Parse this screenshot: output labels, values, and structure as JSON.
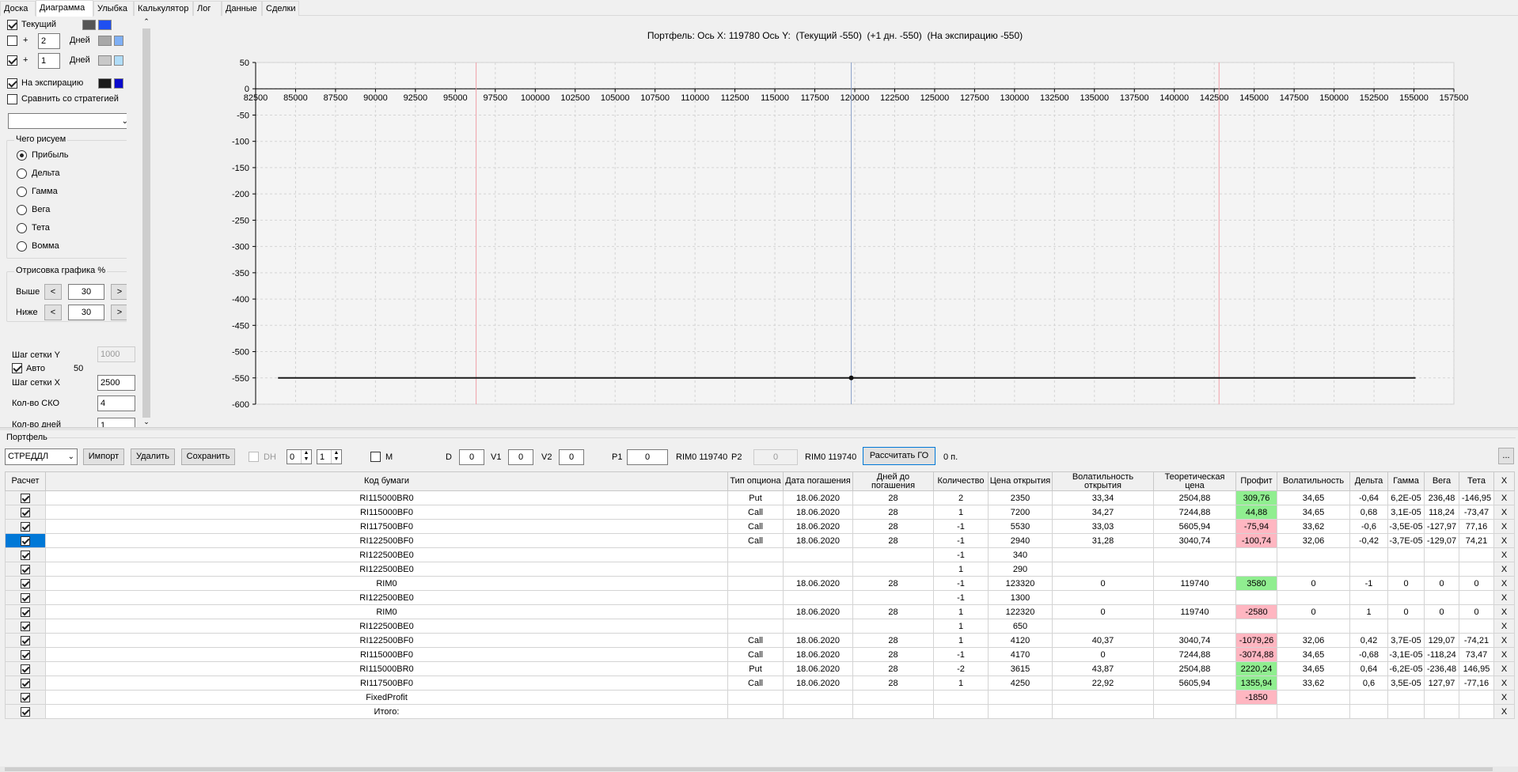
{
  "tabs": [
    "Доска",
    "Диаграмма",
    "Улыбка",
    "Калькулятор",
    "Лог",
    "Данные",
    "Сделки"
  ],
  "active_tab": "Диаграмма",
  "left_panel": {
    "current_label": "Текущий",
    "plus": "+",
    "days_label": "Дней",
    "days_1": "2",
    "days_2": "1",
    "expiry_label": "На экспирацию",
    "compare_label": "Сравнить со стратегией",
    "what_group": "Чего рисуем",
    "radio_options": [
      "Прибыль",
      "Дельта",
      "Гамма",
      "Вега",
      "Тета",
      "Вомма"
    ],
    "render_group": "Отрисовка графика %",
    "above_label": "Выше",
    "below_label": "Ниже",
    "above_value": "30",
    "below_value": "30",
    "prev": "<",
    "next": ">",
    "grid_y_label": "Шаг сетки Y",
    "grid_y_value": "1000",
    "auto_label": "Авто",
    "auto_value": "50",
    "grid_x_label": "Шаг сетки X",
    "grid_x_value": "2500",
    "sko_label": "Кол-во СКО",
    "sko_value": "4",
    "days_count_label": "Кол-во дней",
    "days_count_value": "1",
    "colors": {
      "current": [
        "#555555",
        "#1f4ff0"
      ],
      "plus2": [
        "#a8a8a8",
        "#7fb0f5"
      ],
      "plus1": [
        "#c8c8c8",
        "#b0dcf8"
      ],
      "expiry": [
        "#1a1a1a",
        "#0a0acc"
      ]
    }
  },
  "chart_data": {
    "type": "line",
    "title": "Портфель: Ось X: 119780 Ось Y:  (Текущий -550)  (+1 дн. -550)  (На экспирацию -550)",
    "xlabel": "",
    "ylabel": "",
    "xlim": [
      82500,
      157500
    ],
    "ylim": [
      -600,
      50
    ],
    "x_ticks": [
      82500,
      85000,
      87500,
      90000,
      92500,
      95000,
      97500,
      100000,
      102500,
      105000,
      107500,
      110000,
      112500,
      115000,
      117500,
      120000,
      122500,
      125000,
      127500,
      130000,
      132500,
      135000,
      137500,
      140000,
      142500,
      145000,
      147500,
      150000,
      152500,
      155000,
      157500
    ],
    "y_ticks": [
      50,
      0,
      -50,
      -100,
      -150,
      -200,
      -250,
      -300,
      -350,
      -400,
      -450,
      -500,
      -550,
      -600
    ],
    "grid": true,
    "series": [
      {
        "x": [
          83900,
          155100
        ],
        "y": [
          -550,
          -550
        ],
        "color": "#1a1a1a"
      }
    ],
    "marker": {
      "x": 119780,
      "y": -550
    },
    "vertical_lines": [
      {
        "x": 96300,
        "color": "#f0a0a8"
      },
      {
        "x": 119780,
        "color": "#8aa0c8"
      },
      {
        "x": 142800,
        "color": "#f0a0a8"
      }
    ]
  },
  "portfolio": {
    "section_label": "Портфель",
    "strategy": "СТРЕДДЛ",
    "import_btn": "Импорт",
    "delete_btn": "Удалить",
    "save_btn": "Сохранить",
    "dh_label": "DH",
    "dh_v1": "0",
    "dh_v2": "1",
    "m_label": "M",
    "d_label": "D",
    "d_value": "0",
    "v1_label": "V1",
    "v1_value": "0",
    "v2_label": "V2",
    "v2_value": "0",
    "p1_label": "P1",
    "p1_value": "0",
    "rim_text1": "RIM0 119740",
    "p2_label": "P2",
    "p2_value": "0",
    "rim_text2": "RIM0 119740",
    "calc_btn": "Рассчитать ГО",
    "go_value": "0 п.",
    "more_btn": "..."
  },
  "table": {
    "headers": [
      "Расчет",
      "Код бумаги",
      "Тип опциона",
      "Дата погашения",
      "Дней до погашения",
      "Количество",
      "Цена открытия",
      "Волатильность открытия",
      "Теоретическая цена",
      "Профит",
      "Волатильность",
      "Дельта",
      "Гамма",
      "Вега",
      "Тета",
      "X"
    ],
    "rows": [
      [
        "RI115000BR0",
        "Put",
        "18.06.2020",
        "28",
        "2",
        "2350",
        "33,34",
        "2504,88",
        "309,76",
        "34,65",
        "-0,64",
        "6,2E-05",
        "236,48",
        "-146,95"
      ],
      [
        "RI115000BF0",
        "Call",
        "18.06.2020",
        "28",
        "1",
        "7200",
        "34,27",
        "7244,88",
        "44,88",
        "34,65",
        "0,68",
        "3,1E-05",
        "118,24",
        "-73,47"
      ],
      [
        "RI117500BF0",
        "Call",
        "18.06.2020",
        "28",
        "-1",
        "5530",
        "33,03",
        "5605,94",
        "-75,94",
        "33,62",
        "-0,6",
        "-3,5E-05",
        "-127,97",
        "77,16"
      ],
      [
        "RI122500BF0",
        "Call",
        "18.06.2020",
        "28",
        "-1",
        "2940",
        "31,28",
        "3040,74",
        "-100,74",
        "32,06",
        "-0,42",
        "-3,7E-05",
        "-129,07",
        "74,21"
      ],
      [
        "RI122500BE0",
        "",
        "",
        "",
        "-1",
        "340",
        "",
        "",
        "",
        "",
        "",
        "",
        "",
        ""
      ],
      [
        "RI122500BE0",
        "",
        "",
        "",
        "1",
        "290",
        "",
        "",
        "",
        "",
        "",
        "",
        "",
        ""
      ],
      [
        "RIM0",
        "",
        "18.06.2020",
        "28",
        "-1",
        "123320",
        "0",
        "119740",
        "3580",
        "0",
        "-1",
        "0",
        "0",
        "0"
      ],
      [
        "RI122500BE0",
        "",
        "",
        "",
        "-1",
        "1300",
        "",
        "",
        "",
        "",
        "",
        "",
        "",
        ""
      ],
      [
        "RIM0",
        "",
        "18.06.2020",
        "28",
        "1",
        "122320",
        "0",
        "119740",
        "-2580",
        "0",
        "1",
        "0",
        "0",
        "0"
      ],
      [
        "RI122500BE0",
        "",
        "",
        "",
        "1",
        "650",
        "",
        "",
        "",
        "",
        "",
        "",
        "",
        ""
      ],
      [
        "RI122500BF0",
        "Call",
        "18.06.2020",
        "28",
        "1",
        "4120",
        "40,37",
        "3040,74",
        "-1079,26",
        "32,06",
        "0,42",
        "3,7E-05",
        "129,07",
        "-74,21"
      ],
      [
        "RI115000BF0",
        "Call",
        "18.06.2020",
        "28",
        "-1",
        "4170",
        "0",
        "7244,88",
        "-3074,88",
        "34,65",
        "-0,68",
        "-3,1E-05",
        "-118,24",
        "73,47"
      ],
      [
        "RI115000BR0",
        "Put",
        "18.06.2020",
        "28",
        "-2",
        "3615",
        "43,87",
        "2504,88",
        "2220,24",
        "34,65",
        "0,64",
        "-6,2E-05",
        "-236,48",
        "146,95"
      ],
      [
        "RI117500BF0",
        "Call",
        "18.06.2020",
        "28",
        "1",
        "4250",
        "22,92",
        "5605,94",
        "1355,94",
        "33,62",
        "0,6",
        "3,5E-05",
        "127,97",
        "-77,16"
      ],
      [
        "FixedProfit",
        "",
        "",
        "",
        "",
        "",
        "",
        "",
        "-1850",
        "",
        "",
        "",
        "",
        ""
      ],
      [
        "Итого:",
        "",
        "",
        "",
        "",
        "",
        "",
        "",
        "",
        "",
        "",
        "",
        "",
        ""
      ]
    ],
    "delete_mark": "X",
    "selected_row": 3
  }
}
